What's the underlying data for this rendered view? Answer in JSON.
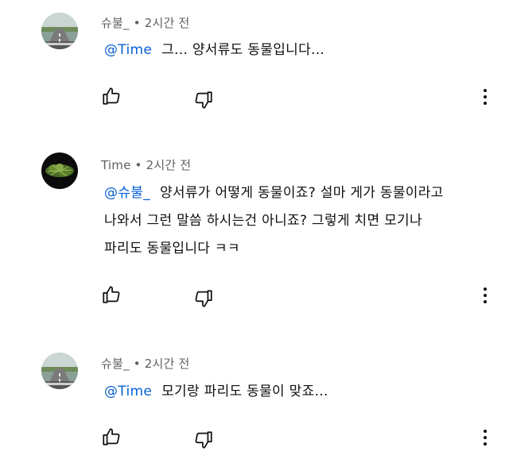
{
  "comments": [
    {
      "author": "슈불_",
      "time": "2시간 전",
      "mention": "@Time",
      "lines": [
        "그... 양서류도 동물입니다..."
      ]
    },
    {
      "author": "Time",
      "time": "2시간 전",
      "mention": "@슈불_",
      "lines": [
        "양서류가 어떻게 동물이죠? 설마 게가 동물이라고",
        "나와서 그런 말씀 하시는건 아니죠? 그렇게 치면 모기나",
        "파리도 동물입니다 ㅋㅋ"
      ]
    },
    {
      "author": "슈불_",
      "time": "2시간 전",
      "mention": "@Time",
      "lines": [
        "모기랑 파리도 동물이 맞죠..."
      ]
    }
  ],
  "separator": "•",
  "icons": {
    "like": "thumbs-up-icon",
    "dislike": "thumbs-down-icon",
    "more": "more-vert-icon"
  }
}
